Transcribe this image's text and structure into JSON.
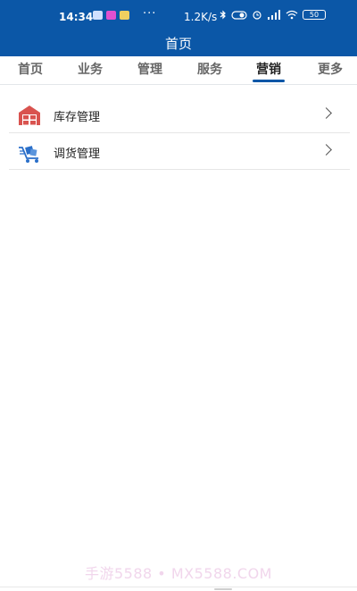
{
  "status_bar": {
    "time": "14:34",
    "dots": "···",
    "network_speed": "1.2K/s",
    "battery": "50"
  },
  "header": {
    "title": "首页"
  },
  "tabs": [
    {
      "label": "首页",
      "active": false
    },
    {
      "label": "业务",
      "active": false
    },
    {
      "label": "管理",
      "active": false
    },
    {
      "label": "服务",
      "active": false
    },
    {
      "label": "营销",
      "active": true
    },
    {
      "label": "更多",
      "active": false
    }
  ],
  "list": {
    "items": [
      {
        "label": "库存管理",
        "icon": "warehouse-icon"
      },
      {
        "label": "调货管理",
        "icon": "transfer-cart-icon"
      }
    ]
  },
  "footer": {
    "watermark": "手游5588 • MX5588.COM"
  },
  "colors": {
    "brand": "#0b57a7",
    "warehouse_icon": "#d9534f",
    "cart_icon": "#2a6fc9"
  }
}
